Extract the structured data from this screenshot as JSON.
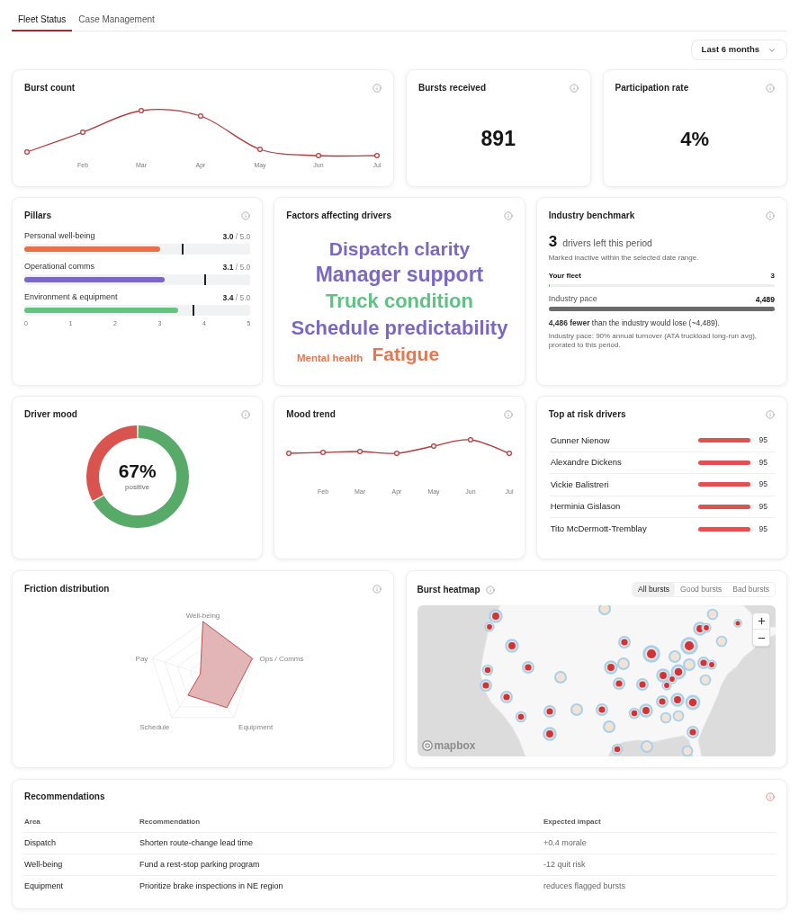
{
  "tabs": [
    {
      "label": "Fleet Status",
      "selected": true
    },
    {
      "label": "Case Management",
      "selected": false
    }
  ],
  "date_range": {
    "value": "Last 6 months"
  },
  "burst_count": {
    "title": "Burst count",
    "x_labels": [
      "Feb",
      "Mar",
      "Apr",
      "May",
      "Jun",
      "Jul"
    ]
  },
  "bursts_received": {
    "title": "Bursts received",
    "value": "891"
  },
  "participation_rate": {
    "title": "Participation rate",
    "value": "4%"
  },
  "pillars": {
    "title": "Pillars",
    "items": [
      {
        "label": "Personal well-being",
        "score": "3.0",
        "max": "/ 5.0",
        "color": "#ea7048",
        "level": 0.6,
        "benchmark": {
          "level": 0.7
        }
      },
      {
        "label": "Operational comms",
        "score": "3.1",
        "max": "/ 5.0",
        "color": "#7c66c6",
        "level": 0.62,
        "benchmark": {
          "level": 0.8
        }
      },
      {
        "label": "Environment & equipment",
        "score": "3.4",
        "max": "/ 5.0",
        "color": "#63c57f",
        "level": 0.68,
        "benchmark": {
          "level": 0.75
        }
      }
    ],
    "scale": [
      "0",
      "1",
      "2",
      "3",
      "4",
      "5"
    ]
  },
  "factors": {
    "title": "Factors affecting drivers",
    "words": [
      {
        "text": "Dispatch clarity",
        "color": "#7b68c2"
      },
      {
        "text": "Manager support",
        "color": "#7b68c2"
      },
      {
        "text": "Truck condition",
        "color": "#5fc283"
      },
      {
        "text": "Schedule predictability",
        "color": "#7b68c2"
      },
      {
        "text": "Mental health",
        "color": "#e9754c"
      },
      {
        "text": "Fatigue",
        "color": "#e9754c"
      }
    ]
  },
  "industry_benchmark": {
    "title": "Industry benchmark",
    "count": "3",
    "count_label": "drivers left this period",
    "note": "Marked inactive within the selected date range.",
    "bars": [
      {
        "kind": "fleet",
        "label": "Your fleet",
        "value": "3",
        "level": 0.006
      },
      {
        "kind": "pace",
        "label": "Industry pace",
        "value": "4,489",
        "level": 1
      }
    ],
    "summary": "**4,486 fewer** than the industry would lose (~4,489).",
    "footnote": "Industry pace: 90% annual turnover (ATA truckload long-run avg), prorated to this period."
  },
  "driver_mood": {
    "title": "Driver mood",
    "value": "67%",
    "label": "positive",
    "chart_data": {
      "type": "donut",
      "values": [
        67,
        33
      ]
    }
  },
  "mood_trend": {
    "title": "Mood trend",
    "x_labels": [
      "Feb",
      "Mar",
      "Apr",
      "May",
      "Jun",
      "Jul"
    ]
  },
  "at_risk_drivers": {
    "title": "Top at risk drivers",
    "drivers": [
      {
        "name": "Gunner Nienow",
        "score": "95",
        "level": 0.95
      },
      {
        "name": "Alexandre Dickens",
        "score": "95",
        "level": 0.95
      },
      {
        "name": "Vickie Balistreri",
        "score": "95",
        "level": 0.95
      },
      {
        "name": "Herminia Gislason",
        "score": "95",
        "level": 0.95
      },
      {
        "name": "Tito McDermott-Tremblay",
        "score": "95",
        "level": 0.95
      }
    ]
  },
  "friction": {
    "title": "Friction distribution",
    "axes": [
      "Well-being",
      "Ops / Comms",
      "Equipment",
      "Schedule",
      "Pay"
    ]
  },
  "heatmap": {
    "title": "Burst heatmap",
    "filters": [
      {
        "label": "All bursts",
        "selected": true
      },
      {
        "label": "Good bursts",
        "selected": false
      },
      {
        "label": "Bad bursts",
        "selected": false
      }
    ],
    "attribution": "mapbox"
  },
  "recommendations": {
    "title": "Recommendations",
    "columns": [
      "Area",
      "Recommendation",
      "Expected impact"
    ],
    "rows": [
      [
        "Dispatch",
        "Shorten route-change lead time",
        "+0.4 morale"
      ],
      [
        "Well-being",
        "Fund a rest-stop parking program",
        "-12 quit risk"
      ],
      [
        "Equipment",
        "Prioritize brake inspections in NE region",
        "reduces flagged bursts"
      ]
    ]
  }
}
